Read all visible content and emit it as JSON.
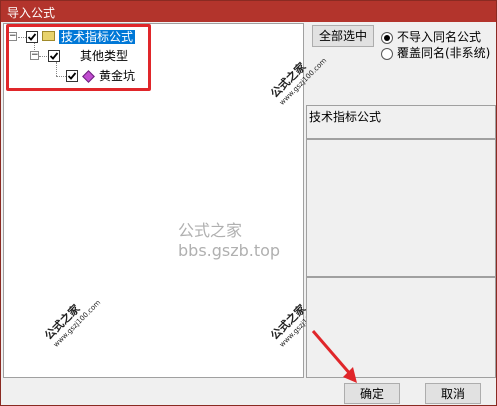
{
  "window": {
    "title": "导入公式",
    "accent_color": "#b3342c"
  },
  "tree": {
    "root": {
      "label": "技术指标公式",
      "checked": true,
      "expanded": true,
      "icon": "folder-icon"
    },
    "child": {
      "label": "其他类型",
      "checked": true,
      "expanded": true
    },
    "leaf": {
      "label": "黄金坑",
      "checked": true,
      "icon": "formula-diamond-icon"
    }
  },
  "options": {
    "select_all_label": "全部选中",
    "radio_no_import_label": "不导入同名公式",
    "radio_overwrite_label": "覆盖同名(非系统)",
    "selected_radio": "不导入同名公式"
  },
  "info_panel": {
    "label": "技术指标公式"
  },
  "watermark": {
    "center_text": "公式之家 bbs.gszb.top",
    "corner_text": "公式之家",
    "corner_url": "www.gszj100.com"
  },
  "buttons": {
    "ok_label": "确定",
    "cancel_label": "取消"
  }
}
